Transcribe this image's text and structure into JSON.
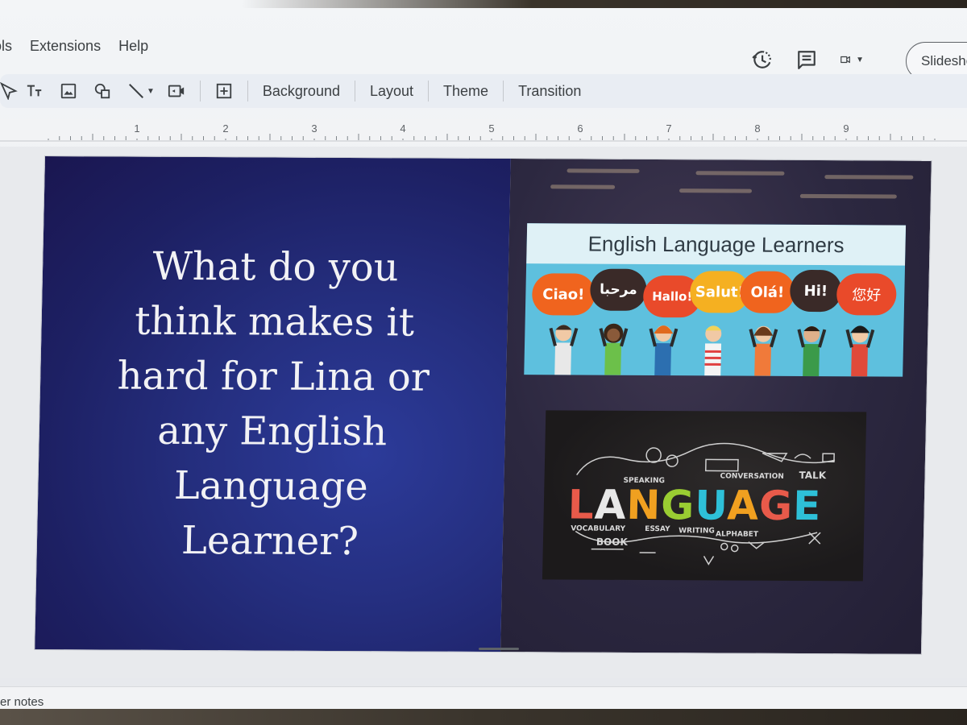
{
  "menubar": {
    "items": [
      "ols",
      "Extensions",
      "Help"
    ]
  },
  "toolbar": {
    "background_label": "Background",
    "layout_label": "Layout",
    "theme_label": "Theme",
    "transition_label": "Transition"
  },
  "topright": {
    "slideshow_label": "Slidesho"
  },
  "ruler": {
    "numbers": [
      "1",
      "2",
      "3",
      "4",
      "5",
      "6",
      "7",
      "8",
      "9"
    ]
  },
  "slide": {
    "question_lines": [
      "What do you",
      "think makes it",
      "hard for Lina or",
      "any English",
      "Language",
      "Learner?"
    ],
    "banner_title": "English Language Learners",
    "greetings": [
      "Ciao!",
      "مرحبا",
      "Hallo!",
      "Salut!",
      "Olá!",
      "Hi!",
      "您好"
    ],
    "language_word": [
      "L",
      "A",
      "N",
      "G",
      "U",
      "A",
      "G",
      "E"
    ],
    "language_tags": [
      "SPEAKING",
      "CONVERSATION",
      "TALK",
      "VOCABULARY",
      "BOOK",
      "ESSAY",
      "WRITING",
      "ALPHABET"
    ]
  },
  "notes": {
    "label": "er notes"
  },
  "colors": {
    "slide_left_bg": "#252f80",
    "banner_bg": "#5ec0de",
    "bubble_orange": "#f0641e",
    "bubble_dark": "#3a2a28",
    "bubble_red": "#e94a2a",
    "bubble_yellow": "#f5b021"
  }
}
